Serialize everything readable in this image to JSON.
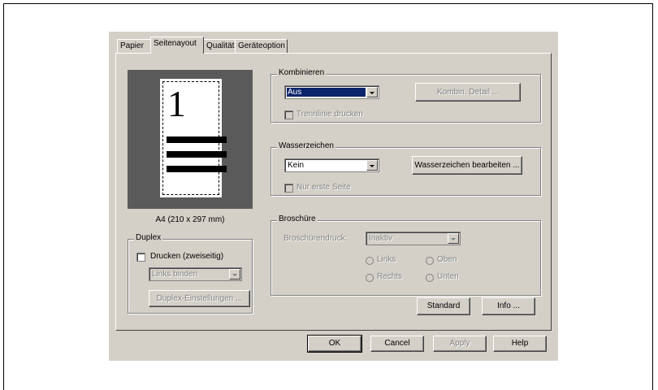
{
  "tabs": [
    "Papier",
    "Seitenayout",
    "Qualität",
    "Geräteoption"
  ],
  "preview": {
    "page_number": "1",
    "paper_label": "A4 (210 x 297 mm)"
  },
  "kombinieren": {
    "title": "Kombinieren",
    "combo_value": "Aus",
    "detail_button": "Kombin. Detail ...",
    "trennlinie_label": "Trennlinie drucken"
  },
  "wasserzeichen": {
    "title": "Wasserzeichen",
    "combo_value": "Kein",
    "edit_button": "Wasserzeichen bearbeiten ...",
    "first_page_label": "Nur erste Seite"
  },
  "duplex": {
    "title": "Duplex",
    "print_label": "Drucken (zweiseitig)",
    "binding_value": "Links binden",
    "settings_button": "Duplex-Einstellungen ..."
  },
  "broschuere": {
    "title": "Broschüre",
    "druck_label": "Broschürendruck:",
    "druck_value": "Inaktiv",
    "radio_links": "Links",
    "radio_oben": "Oben",
    "radio_rechts": "Rechts",
    "radio_unten": "Unten"
  },
  "buttons": {
    "standard": "Standard",
    "info": "Info ...",
    "ok": "OK",
    "cancel": "Cancel",
    "apply": "Apply",
    "help": "Help"
  },
  "colors": {
    "dialog_bg": "#d4d0c8",
    "preview_bg": "#5a5a5a",
    "selection": "#0a246a"
  }
}
